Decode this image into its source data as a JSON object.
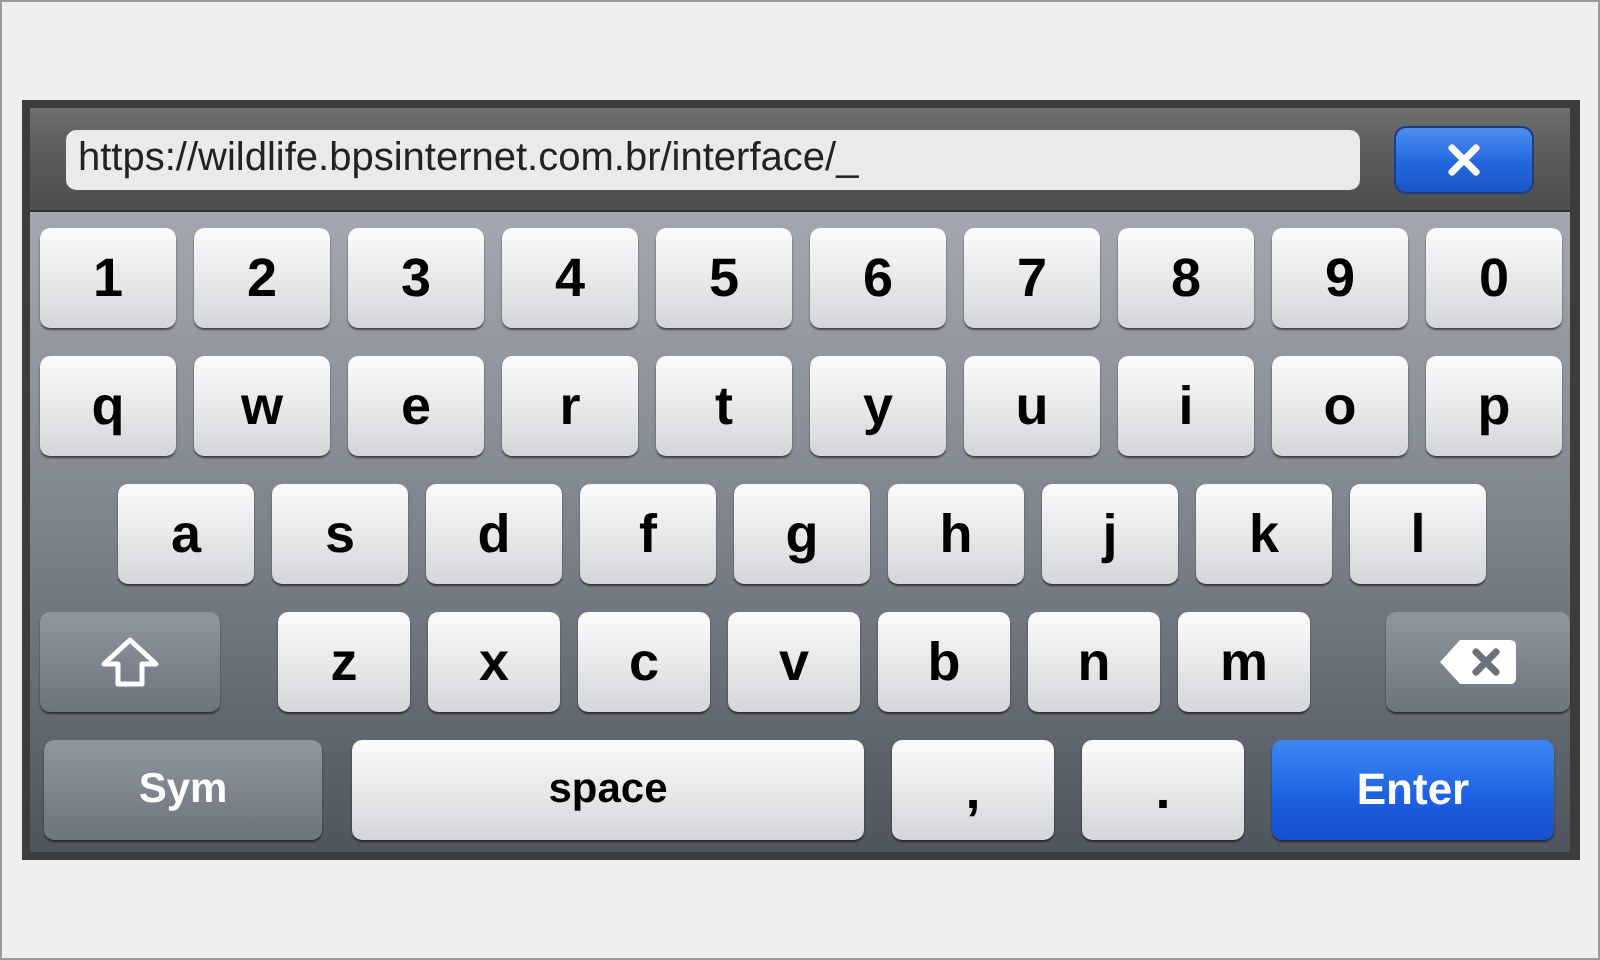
{
  "address_bar": {
    "value": "https://wildlife.bpsinternet.com.br/interface/_"
  },
  "close_button": {
    "kind": "close"
  },
  "keyboard": {
    "rows": [
      {
        "keys": [
          {
            "kind": "char",
            "label": "1"
          },
          {
            "kind": "char",
            "label": "2"
          },
          {
            "kind": "char",
            "label": "3"
          },
          {
            "kind": "char",
            "label": "4"
          },
          {
            "kind": "char",
            "label": "5"
          },
          {
            "kind": "char",
            "label": "6"
          },
          {
            "kind": "char",
            "label": "7"
          },
          {
            "kind": "char",
            "label": "8"
          },
          {
            "kind": "char",
            "label": "9"
          },
          {
            "kind": "char",
            "label": "0"
          }
        ]
      },
      {
        "keys": [
          {
            "kind": "char",
            "label": "q"
          },
          {
            "kind": "char",
            "label": "w"
          },
          {
            "kind": "char",
            "label": "e"
          },
          {
            "kind": "char",
            "label": "r"
          },
          {
            "kind": "char",
            "label": "t"
          },
          {
            "kind": "char",
            "label": "y"
          },
          {
            "kind": "char",
            "label": "u"
          },
          {
            "kind": "char",
            "label": "i"
          },
          {
            "kind": "char",
            "label": "o"
          },
          {
            "kind": "char",
            "label": "p"
          }
        ]
      },
      {
        "keys": [
          {
            "kind": "char",
            "label": "a"
          },
          {
            "kind": "char",
            "label": "s"
          },
          {
            "kind": "char",
            "label": "d"
          },
          {
            "kind": "char",
            "label": "f"
          },
          {
            "kind": "char",
            "label": "g"
          },
          {
            "kind": "char",
            "label": "h"
          },
          {
            "kind": "char",
            "label": "j"
          },
          {
            "kind": "char",
            "label": "k"
          },
          {
            "kind": "char",
            "label": "l"
          }
        ]
      },
      {
        "keys": [
          {
            "kind": "shift"
          },
          {
            "kind": "char",
            "label": "z"
          },
          {
            "kind": "char",
            "label": "x"
          },
          {
            "kind": "char",
            "label": "c"
          },
          {
            "kind": "char",
            "label": "v"
          },
          {
            "kind": "char",
            "label": "b"
          },
          {
            "kind": "char",
            "label": "n"
          },
          {
            "kind": "char",
            "label": "m"
          },
          {
            "kind": "backspace"
          }
        ]
      },
      {
        "keys": [
          {
            "kind": "sym",
            "label": "Sym"
          },
          {
            "kind": "space",
            "label": "space"
          },
          {
            "kind": "punct",
            "label": ","
          },
          {
            "kind": "punct",
            "label": "."
          },
          {
            "kind": "enter",
            "label": "Enter"
          }
        ]
      }
    ]
  }
}
